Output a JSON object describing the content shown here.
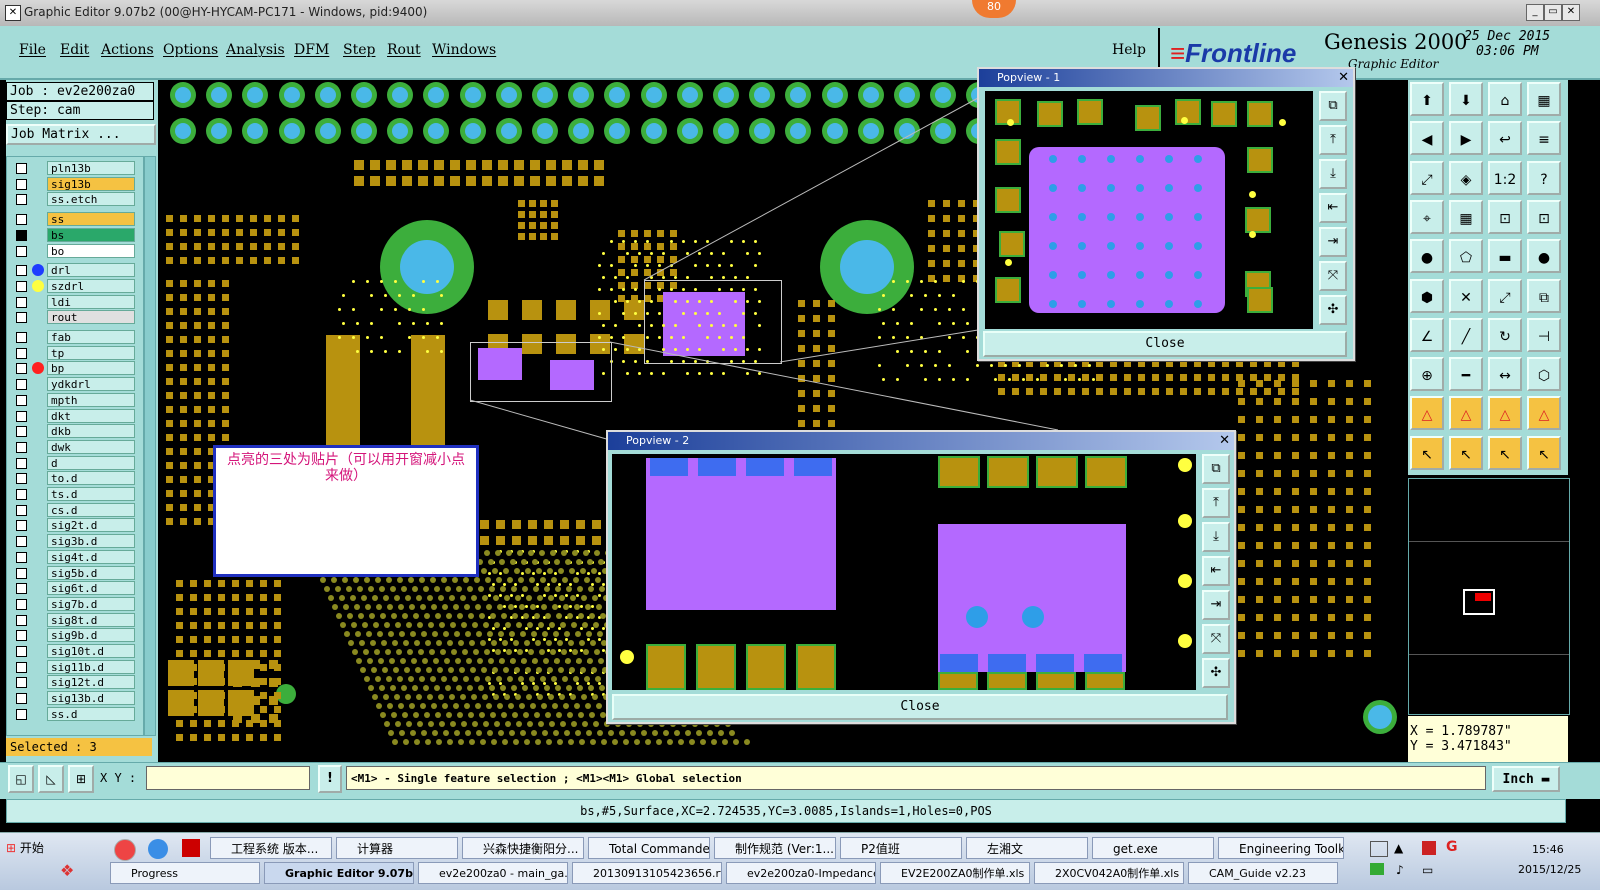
{
  "window": {
    "title": "Graphic Editor 9.07b2 (00@HY-HYCAM-PC171 - Windows, pid:9400)",
    "badge": "80"
  },
  "menu": [
    "File",
    "Edit",
    "Actions",
    "Options",
    "Analysis",
    "DFM",
    "Step",
    "Rout",
    "Windows"
  ],
  "help_label": "Help",
  "brand": {
    "logo": "Frontline",
    "product": "Genesis 2000",
    "subtitle": "Graphic Editor",
    "date": "25 Dec 2015",
    "time": "03:06 PM"
  },
  "job": {
    "job_label": "Job : ev2e200za0",
    "step_label": "Step: cam",
    "matrix_button": "Job Matrix ..."
  },
  "layers": [
    {
      "name": "pln13b",
      "state": "off"
    },
    {
      "name": "sig13b",
      "state": "off",
      "highlight": "#f5c242"
    },
    {
      "name": "ss.etch",
      "state": "off"
    },
    {
      "name": "ss",
      "state": "off",
      "highlight": "#f5c242"
    },
    {
      "name": "bs",
      "state": "on",
      "highlight": "#2aa86a"
    },
    {
      "name": "bo",
      "state": "off",
      "highlight": "#ffffff"
    },
    {
      "name": "drl",
      "state": "off",
      "dot": "#1e3cff"
    },
    {
      "name": "szdrl",
      "state": "off",
      "dot": "#ffff40"
    },
    {
      "name": "ldi",
      "state": "off"
    },
    {
      "name": "rout",
      "state": "off",
      "highlight": "#e0e0e0"
    },
    {
      "name": "fab",
      "state": "off"
    },
    {
      "name": "tp",
      "state": "off"
    },
    {
      "name": "bp",
      "state": "off",
      "dot": "#ff2020"
    },
    {
      "name": "ydkdrl",
      "state": "off"
    },
    {
      "name": "mpth",
      "state": "off"
    },
    {
      "name": "dkt",
      "state": "off"
    },
    {
      "name": "dkb",
      "state": "off"
    },
    {
      "name": "dwk",
      "state": "off"
    },
    {
      "name": "d",
      "state": "off"
    },
    {
      "name": "to.d",
      "state": "off"
    },
    {
      "name": "ts.d",
      "state": "off"
    },
    {
      "name": "cs.d",
      "state": "off"
    },
    {
      "name": "sig2t.d",
      "state": "off"
    },
    {
      "name": "sig3b.d",
      "state": "off"
    },
    {
      "name": "sig4t.d",
      "state": "off"
    },
    {
      "name": "sig5b.d",
      "state": "off"
    },
    {
      "name": "sig6t.d",
      "state": "off"
    },
    {
      "name": "sig7b.d",
      "state": "off"
    },
    {
      "name": "sig8t.d",
      "state": "off"
    },
    {
      "name": "sig9b.d",
      "state": "off"
    },
    {
      "name": "sig10t.d",
      "state": "off"
    },
    {
      "name": "sig11b.d",
      "state": "off"
    },
    {
      "name": "sig12t.d",
      "state": "off"
    },
    {
      "name": "sig13b.d",
      "state": "off"
    },
    {
      "name": "ss.d",
      "state": "off"
    }
  ],
  "selected_label": "Selected : 3",
  "annotation_note": "点亮的三处为贴片（可以用开窗减小点来做）",
  "popview1": {
    "title": "Popview - 1",
    "close_label": "Close"
  },
  "popview2": {
    "title": "Popview - 2",
    "close_label": "Close"
  },
  "coords": {
    "x": "X = 1.789787\"",
    "y": "Y = 3.471843\""
  },
  "xy_label": "X Y :",
  "xy_value": "",
  "hint": "<M1> - Single feature selection ; <M1><M1> Global selection",
  "units": "Inch",
  "status": "bs,#5,Surface,XC=2.724535,YC=3.0085,Islands=1,Holes=0,POS",
  "taskbar_row1": [
    "开始",
    "工程系统  版本...",
    "计算器",
    "兴森快捷衡阳分...",
    "Total Commander ...",
    "制作规范 (Ver:1....",
    "P2值班",
    "左湘文",
    "get.exe",
    "Engineering Toolki..."
  ],
  "taskbar_row2": [
    "Progress",
    "Graphic Editor 9.07b2",
    "ev2e200za0 - main_ga...",
    "20130913105423656.rt...",
    "ev2e200za0-Impedance...",
    "EV2E200ZA0制作单.xls",
    "2X0CV042A0制作单.xls",
    "CAM_Guide v2.23"
  ],
  "clock": {
    "time": "15:46",
    "date": "2015/12/25"
  },
  "colors": {
    "panel": "#a4dcd8",
    "pad": "#b8920f",
    "ring": "#3cae3c",
    "hole": "#4ab8e8",
    "surface": "#b469ff",
    "note_text": "#d4147a"
  }
}
